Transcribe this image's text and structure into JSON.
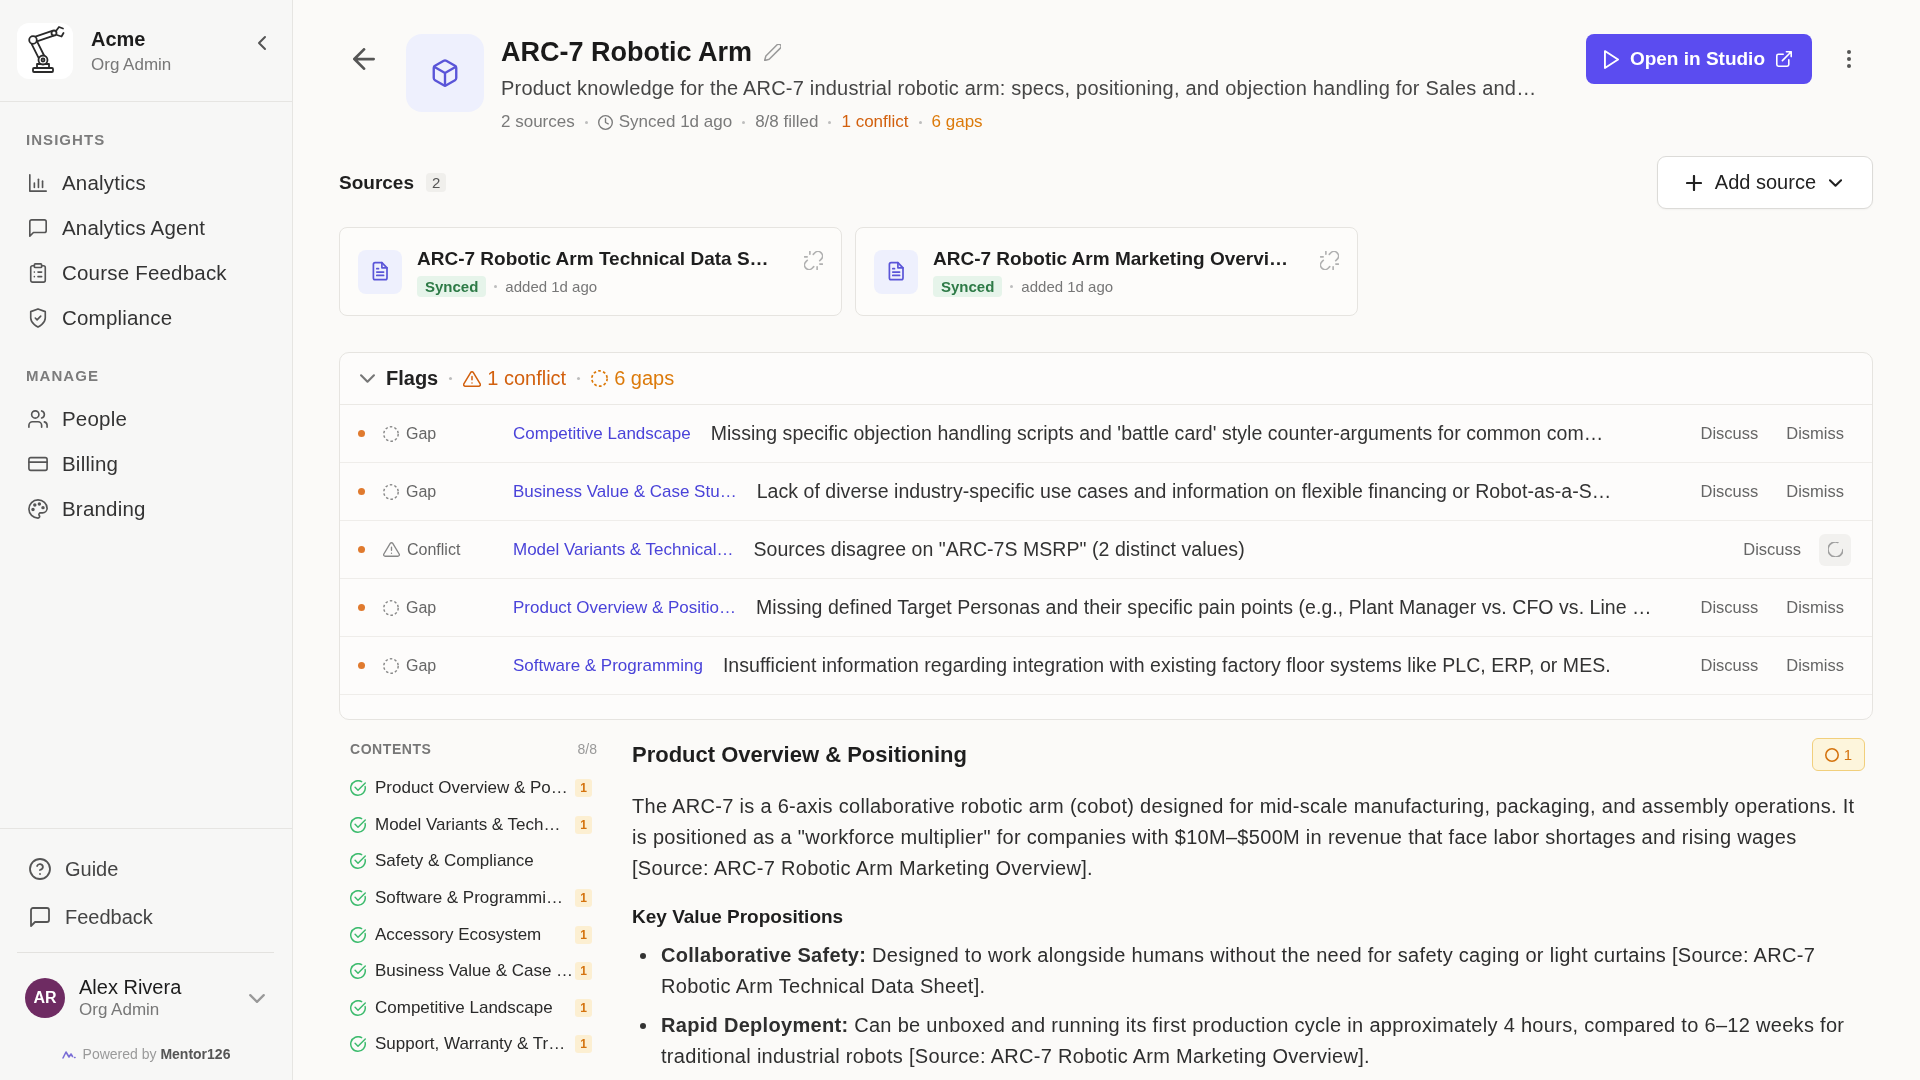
{
  "sidebar": {
    "org": {
      "name": "Acme",
      "role": "Org Admin"
    },
    "sections": [
      {
        "heading": "INSIGHTS",
        "items": [
          "Analytics",
          "Analytics Agent",
          "Course Feedback",
          "Compliance"
        ]
      },
      {
        "heading": "MANAGE",
        "items": [
          "People",
          "Billing",
          "Branding"
        ]
      }
    ],
    "footer_links": [
      "Guide",
      "Feedback"
    ],
    "user": {
      "initials": "AR",
      "name": "Alex Rivera",
      "role": "Org Admin"
    },
    "powered_by": "Powered by **Mentor126**"
  },
  "header": {
    "title": "ARC-7 Robotic Arm",
    "description": "Product knowledge for the ARC-7 industrial robotic arm: specs, positioning, and objection handling for Sales and…",
    "meta": [
      {
        "kind": "plain",
        "text": "2 sources"
      },
      {
        "kind": "synced",
        "text": "Synced 1d ago"
      },
      {
        "kind": "plain",
        "text": "8/8 filled"
      },
      {
        "kind": "conflict",
        "text": "1 conflict"
      },
      {
        "kind": "gap",
        "text": "6 gaps"
      }
    ],
    "primary_button": "Open in Studio"
  },
  "sources": {
    "title": "Sources",
    "count": "2",
    "add_button": "Add source",
    "items": [
      {
        "title": "ARC-7 Robotic Arm Technical Data S…",
        "status": "Synced",
        "added": "added 1d ago"
      },
      {
        "title": "ARC-7 Robotic Arm Marketing Overvi…",
        "status": "Synced",
        "added": "added 1d ago"
      }
    ]
  },
  "flags": {
    "title": "Flags",
    "expanded": true,
    "conflicts": "1 conflict",
    "gaps": "6 gaps",
    "rows": [
      {
        "kind": "gap",
        "type": "Gap",
        "section": "Competitive Landscape",
        "message": "Missing specific objection handling scripts and 'battle card' style counter-arguments for common com…",
        "actions": [
          {
            "kind": "button",
            "label": "Discuss"
          },
          {
            "kind": "button",
            "label": "Dismiss"
          }
        ]
      },
      {
        "kind": "gap",
        "type": "Gap",
        "section": "Business Value & Case Stu…",
        "message": "Lack of diverse industry-specific use cases and information on flexible financing or Robot-as-a-S…",
        "actions": [
          {
            "kind": "button",
            "label": "Discuss"
          },
          {
            "kind": "button",
            "label": "Dismiss"
          }
        ]
      },
      {
        "kind": "conflict",
        "type": "Conflict",
        "section": "Model Variants & Technical…",
        "message": "Sources disagree on \"ARC-7S MSRP\" (2 distinct values)",
        "actions": [
          {
            "kind": "button",
            "label": "Discuss"
          },
          {
            "kind": "loading"
          }
        ]
      },
      {
        "kind": "gap",
        "type": "Gap",
        "section": "Product Overview & Positio…",
        "message": "Missing defined Target Personas and their specific pain points (e.g., Plant Manager vs. CFO vs. Line …",
        "actions": [
          {
            "kind": "button",
            "label": "Discuss"
          },
          {
            "kind": "button",
            "label": "Dismiss"
          }
        ]
      },
      {
        "kind": "gap",
        "type": "Gap",
        "section": "Software & Programming",
        "message": "Insufficient information regarding integration with existing factory floor systems like PLC, ERP, or MES.",
        "actions": [
          {
            "kind": "button",
            "label": "Discuss"
          },
          {
            "kind": "button",
            "label": "Dismiss"
          }
        ]
      }
    ]
  },
  "contents": {
    "title": "CONTENTS",
    "section_count": "8/8",
    "items": [
      {
        "title": "Product Overview & Po…",
        "complete": true,
        "flags": "1"
      },
      {
        "title": "Model Variants & Tech…",
        "complete": true,
        "flags": "1"
      },
      {
        "title": "Safety & Compliance",
        "complete": true
      },
      {
        "title": "Software & Programmi…",
        "complete": true,
        "flags": "1"
      },
      {
        "title": "Accessory Ecosystem",
        "complete": true,
        "flags": "1"
      },
      {
        "title": "Business Value & Case …",
        "complete": true,
        "flags": "1"
      },
      {
        "title": "Competitive Landscape",
        "complete": true,
        "flags": "1"
      },
      {
        "title": "Support, Warranty & Tr…",
        "complete": true,
        "flags": "1"
      }
    ]
  },
  "article": {
    "title": "Product Overview & Positioning",
    "flag_count": "1",
    "paragraph": "The ARC-7 is a 6-axis collaborative robotic arm (cobot) designed for mid-scale manufacturing, packaging, and assembly operations. It is positioned as a \"workforce multiplier\" for companies with $10M–$500M in revenue that face labor shortages and rising wages [Source: ARC-7 Robotic Arm Marketing Overview].",
    "subheading": "Key Value Propositions",
    "bullets": [
      "**Collaborative Safety:** Designed to work alongside humans without the need for safety caging or light curtains [Source: ARC-7 Robotic Arm Technical Data Sheet].",
      "**Rapid Deployment:** Can be unboxed and running its first production cycle in approximately 4 hours, compared to 6–12 weeks for traditional industrial robots [Source: ARC-7 Robotic Arm Marketing Overview]."
    ]
  }
}
